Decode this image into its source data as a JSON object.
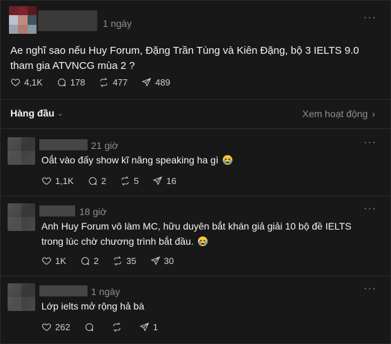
{
  "post": {
    "timestamp": "1 ngày",
    "text": "Ae nghĩ sao nếu Huy Forum, Đặng Trần Tùng và Kiên Đặng, bộ 3 IELTS 9.0 tham gia ATVNCG mùa 2 ?",
    "likes": "4,1K",
    "comments": "178",
    "reposts": "477",
    "shares": "489",
    "more": "···"
  },
  "sort": {
    "label": "Hàng đầu",
    "activity": "Xem hoạt động"
  },
  "replies": [
    {
      "timestamp": "21 giờ",
      "text": "Oắt vào đấy show kĩ năng speaking ha gì",
      "emoji": "loudly-crying-face",
      "likes": "1,1K",
      "comments": "2",
      "reposts": "5",
      "shares": "16"
    },
    {
      "timestamp": "18 giờ",
      "text": "Anh Huy Forum vô làm MC, hữu duyên bắt khán giả giải 10 bộ đề IELTS trong lúc chờ chương trình bắt đầu.",
      "emoji": "loudly-crying-face",
      "likes": "1K",
      "comments": "2",
      "reposts": "35",
      "shares": "30"
    },
    {
      "timestamp": "1 ngày",
      "text": "Lớp ielts mở rộng hả bà",
      "emoji": "",
      "likes": "262",
      "comments": "",
      "reposts": "",
      "shares": "1"
    }
  ],
  "colors": {
    "background": "#181818",
    "text": "#f3f5f7",
    "muted": "#8f8f8f",
    "divider": "#2c2c2c"
  }
}
